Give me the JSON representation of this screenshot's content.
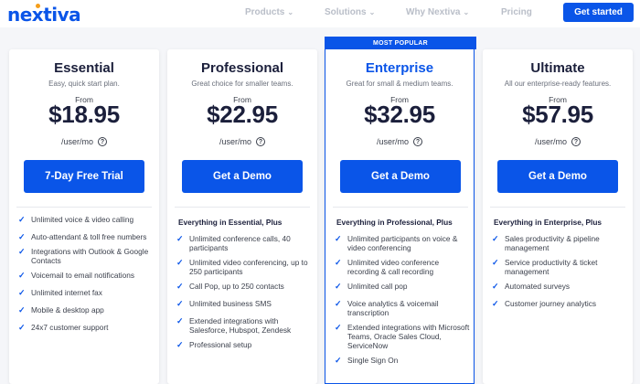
{
  "header": {
    "logo": "nextiva",
    "nav": [
      {
        "label": "Products"
      },
      {
        "label": "Solutions"
      },
      {
        "label": "Why Nextiva"
      },
      {
        "label": "Pricing"
      }
    ],
    "cta_label": "Get started"
  },
  "popular_badge": "MOST POPULAR",
  "plans": [
    {
      "name": "Essential",
      "tagline": "Easy, quick start plan.",
      "from": "From",
      "price": "$18.95",
      "unit": "/user/mo",
      "info": "?",
      "cta": "7-Day Free Trial",
      "plus": "",
      "features": [
        "Unlimited voice & video calling",
        "Auto-attendant & toll free numbers",
        "Integrations with Outlook & Google Contacts",
        "Voicemail to email notifications",
        "Unlimited internet fax",
        "Mobile & desktop app",
        "24x7 customer support"
      ]
    },
    {
      "name": "Professional",
      "tagline": "Great choice for smaller teams.",
      "from": "From",
      "price": "$22.95",
      "unit": "/user/mo",
      "info": "?",
      "cta": "Get a Demo",
      "plus": "Everything in Essential, Plus",
      "features": [
        "Unlimited conference calls, 40 participants",
        "Unlimited video conferencing, up to 250 participants",
        "Call Pop, up to 250 contacts",
        "Unlimited business SMS",
        "Extended integrations with Salesforce, Hubspot, Zendesk",
        "Professional setup"
      ]
    },
    {
      "name": "Enterprise",
      "tagline": "Great for small & medium teams.",
      "from": "From",
      "price": "$32.95",
      "unit": "/user/mo",
      "info": "?",
      "cta": "Get a Demo",
      "plus": "Everything in Professional, Plus",
      "features": [
        "Unlimited participants on voice & video conferencing",
        "Unlimited video conference recording & call recording",
        "Unlimited call pop",
        "Voice analytics & voicemail transcription",
        "Extended integrations with Microsoft Teams, Oracle Sales Cloud, ServiceNow",
        "Single Sign On"
      ]
    },
    {
      "name": "Ultimate",
      "tagline": "All our enterprise-ready features.",
      "from": "From",
      "price": "$57.95",
      "unit": "/user/mo",
      "info": "?",
      "cta": "Get a Demo",
      "plus": "Everything in Enterprise, Plus",
      "features": [
        "Sales productivity & pipeline management",
        "Service productivity & ticket management",
        "Automated surveys",
        "Customer journey analytics"
      ]
    }
  ],
  "colors": {
    "brand": "#0a55e8",
    "logo_dot": "#f59e1a",
    "nav_text": "#b9bec8",
    "heading": "#1b1f3b"
  },
  "icons": {
    "check": "check-icon",
    "info": "info-icon",
    "chevron": "chevron-down-icon"
  }
}
